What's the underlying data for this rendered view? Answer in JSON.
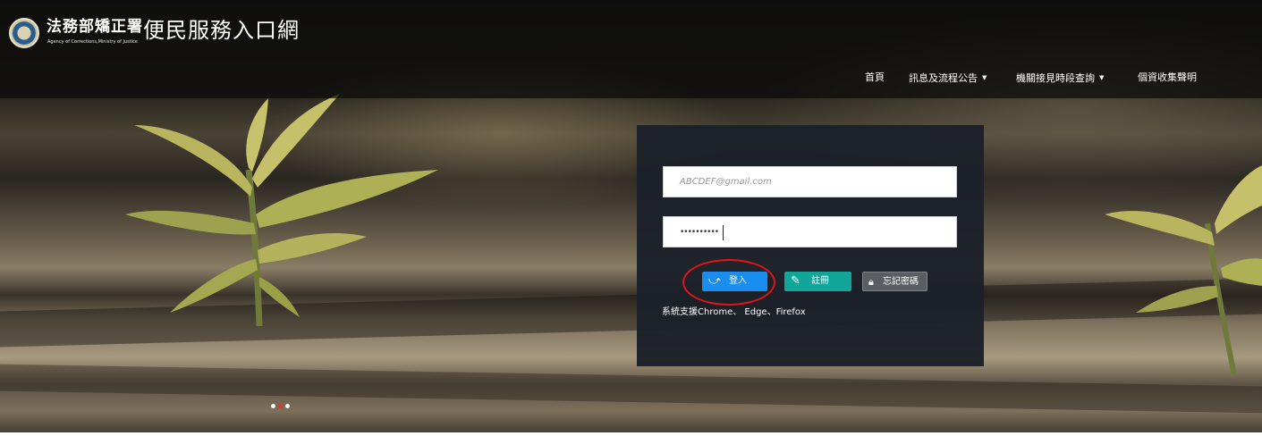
{
  "header": {
    "org_name_zh": "法務部矯正署",
    "org_name_en": "Agency of Corrections,Ministry of Justice",
    "site_title": "便民服務入口網",
    "seal_icon": "seal-logo-icon"
  },
  "nav": {
    "items": [
      {
        "label": "首頁",
        "dropdown": false
      },
      {
        "label": "訊息及流程公告",
        "dropdown": true
      },
      {
        "label": "機關接見時段查詢",
        "dropdown": true
      },
      {
        "label": "個資收集聲明",
        "dropdown": false
      }
    ],
    "caret": "▼"
  },
  "login": {
    "email_value": "ABCDEF@gmail.com",
    "password_mask": "••••••••••",
    "login_label": "登入",
    "login_icon": "login-arrow-icon",
    "register_label": "註冊",
    "register_icon": "register-icon",
    "forgot_label": "忘記密碼",
    "forgot_icon": "lock-icon",
    "support_text": "系統支援Chrome、 Edge、Firefox"
  },
  "carousel": {
    "slide_count": 3,
    "active_index": 1
  },
  "colors": {
    "login_button": "#1a8ef0",
    "register_button": "#12a69a",
    "forgot_button": "#5a5d62",
    "highlight": "#e1141c",
    "panel": "#1c2028"
  }
}
